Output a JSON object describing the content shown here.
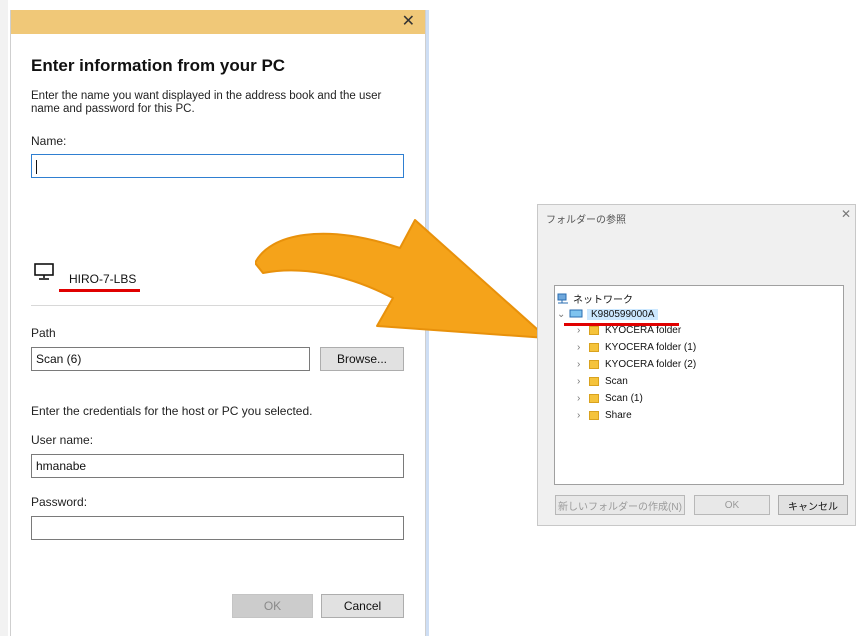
{
  "left_dialog": {
    "close_glyph": "✕",
    "heading": "Enter information from your PC",
    "description": "Enter the name you want displayed in the address book and the user name and password for this PC.",
    "name_label": "Name:",
    "name_value": "",
    "pc_icon": "monitor-icon",
    "pc_name": "HIRO-7-LBS",
    "path_label": "Path",
    "path_value": "Scan (6)",
    "browse_label": "Browse...",
    "credentials_text": "Enter the credentials for the host or PC you selected.",
    "username_label": "User name:",
    "username_value": "hmanabe",
    "password_label": "Password:",
    "password_value": "",
    "ok_label": "OK",
    "cancel_label": "Cancel"
  },
  "right_dialog": {
    "title": "フォルダーの参照",
    "close_glyph": "✕",
    "tree": {
      "root_label": "ネットワーク",
      "computer_label": "K980599000A",
      "folders": [
        "KYOCERA folder",
        "KYOCERA folder (1)",
        "KYOCERA folder (2)",
        "Scan",
        "Scan (1)",
        "Share"
      ]
    },
    "new_folder_label": "新しいフォルダーの作成(N)",
    "ok_label": "OK",
    "cancel_label": "キャンセル"
  },
  "colors": {
    "annotation_red": "#e00000",
    "arrow_orange": "#f5a31a",
    "titlebar": "#f0c878"
  }
}
